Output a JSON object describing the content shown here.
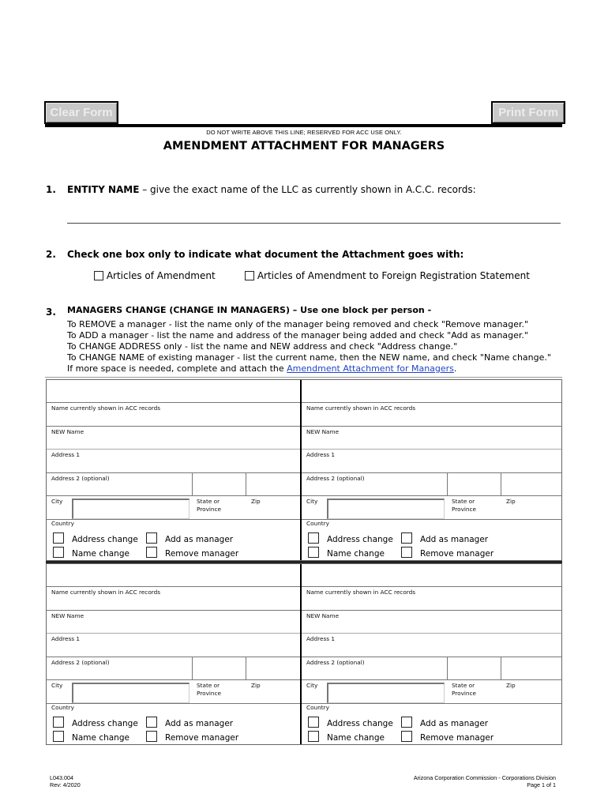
{
  "buttons": {
    "clear": "Clear Form",
    "print": "Print Form"
  },
  "reserved_notice": "DO NOT WRITE ABOVE THIS LINE; RESERVED FOR ACC USE ONLY.",
  "title": "AMENDMENT ATTACHMENT FOR MANAGERS",
  "section1": {
    "number": "1.",
    "heading": "ENTITY NAME",
    "text": " – give the exact name of the LLC as currently shown in A.C.C. records:",
    "entity_name_value": ""
  },
  "section2": {
    "number": "2.",
    "heading": "Check one box only to indicate what document the Attachment goes with:",
    "options": [
      {
        "label": "Articles of Amendment",
        "checked": false
      },
      {
        "label": "Articles of Amendment to Foreign Registration Statement",
        "checked": false
      }
    ]
  },
  "section3": {
    "number": "3.",
    "heading": "MANAGERS CHANGE (CHANGE IN MANAGERS) – Use one block per person -",
    "instructions": [
      "To REMOVE a manager - list the name only of the manager being removed and check \"Remove manager.\"",
      "To ADD  a manager - list the name and address of the manager being added and check \"Add as manager.\"",
      "To CHANGE ADDRESS only - list the name and NEW address and check \"Address change.\"",
      "To CHANGE NAME of existing manager - list the current name, then the NEW name, and check \"Name change.\""
    ],
    "more_space_prefix": "If more space is needed, complete and attach the ",
    "more_space_link": "Amendment Attachment for Managers",
    "more_space_suffix": "."
  },
  "block_labels": {
    "current_name": "Name currently shown in ACC records",
    "new_name": "NEW Name",
    "address1": "Address 1",
    "address2": "Address 2 (optional)",
    "city": "City",
    "state_line1": "State or",
    "state_line2": "Province",
    "zip": "Zip",
    "country": "Country",
    "address_change": "Address change",
    "add_manager": "Add as manager",
    "name_change": "Name change",
    "remove_manager": "Remove manager"
  },
  "manager_blocks": [
    {
      "position": "top-left"
    },
    {
      "position": "top-right"
    },
    {
      "position": "bottom-left"
    },
    {
      "position": "bottom-right"
    }
  ],
  "footer": {
    "form_code": "L043.004",
    "revision": "Rev: 4/2020",
    "agency": "Arizona Corporation Commission - Corporations Division",
    "page": "Page 1 of 1"
  }
}
